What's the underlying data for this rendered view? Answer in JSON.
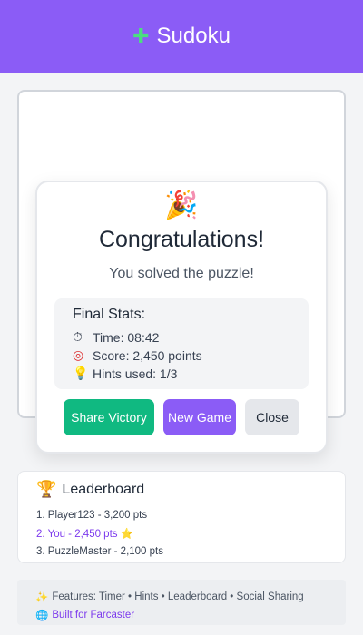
{
  "header": {
    "title": "Sudoku",
    "logo_icon": "puzzle-piece-icon"
  },
  "modal": {
    "emoji": "🎉",
    "title": "Congratulations!",
    "subtitle": "You solved the puzzle!",
    "stats": {
      "title": "Final Stats:",
      "items": [
        {
          "icon": "⏱",
          "icon_name": "stopwatch-icon",
          "text": "Time: 08:42"
        },
        {
          "icon": "◎",
          "icon_name": "target-icon",
          "text": "Score: 2,450 points"
        },
        {
          "icon": "💡",
          "icon_name": "lightbulb-icon",
          "text": "Hints used: 1/3"
        }
      ]
    },
    "buttons": {
      "share": "Share Victory",
      "new_game": "New Game",
      "close": "Close"
    }
  },
  "leaderboard": {
    "icon": "🏆",
    "title": "Leaderboard",
    "entries": [
      "1. Player123 - 3,200 pts",
      "2. You - 2,450 pts",
      "3. PuzzleMaster - 2,100 pts"
    ],
    "you_star": "⭐"
  },
  "footer": {
    "features": "Features: Timer • Hints • Leaderboard • Social Sharing",
    "link": "Built for Farcaster"
  },
  "colors": {
    "header": "#8b5cf6",
    "share_button": "#10b981",
    "new_game_button": "#8b5cf6",
    "close_button": "#e5e7eb",
    "highlight_text": "#7c3aed"
  }
}
